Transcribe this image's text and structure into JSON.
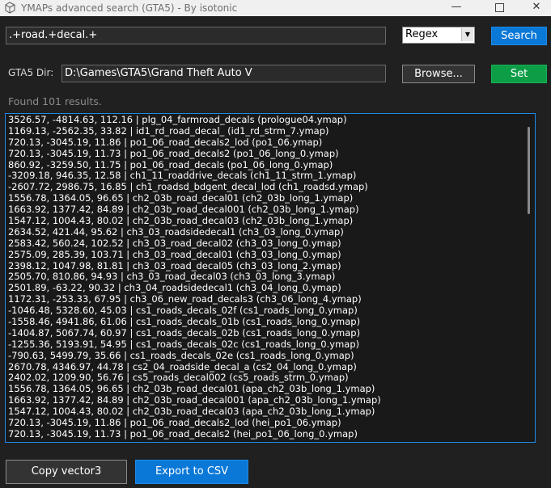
{
  "window": {
    "title": "YMAPs advanced search (GTA5) - By isotonic",
    "minimize_glyph": "—",
    "close_glyph": "✕"
  },
  "search": {
    "query": ".+road.+decal.+",
    "mode": "Regex",
    "button_label": "Search"
  },
  "dir": {
    "label": "GTA5 Dir:",
    "path": "D:\\Games\\GTA5\\Grand Theft Auto V",
    "browse_label": "Browse...",
    "set_label": "Set"
  },
  "status": "Found 101 results.",
  "results": [
    "3526.57, -4814.63, 112.16 | plg_04_farmroad_decals (prologue04.ymap)",
    "1169.13, -2562.35, 33.82 | id1_rd_road_decal_ (id1_rd_strm_7.ymap)",
    "720.13, -3045.19, 11.86 | po1_06_road_decals2_lod (po1_06.ymap)",
    "720.13, -3045.19, 11.73 | po1_06_road_decals2 (po1_06_long_0.ymap)",
    "860.92, -3259.50, 11.75 | po1_06_road_decals (po1_06_long_0.ymap)",
    "-3209.18, 946.35, 12.58 | ch1_11_roaddrive_decals (ch1_11_strm_1.ymap)",
    "-2607.72, 2986.75, 16.85 | ch1_roadsd_bdgent_decal_lod (ch1_roadsd.ymap)",
    "1556.78, 1364.05, 96.65 | ch2_03b_road_decal01 (ch2_03b_long_1.ymap)",
    "1663.92, 1377.42, 84.89 | ch2_03b_road_decal001 (ch2_03b_long_1.ymap)",
    "1547.12, 1004.43, 80.02 | ch2_03b_road_decal03 (ch2_03b_long_1.ymap)",
    "2634.52, 421.44, 95.62 | ch3_03_roadsidedecal1 (ch3_03_long_0.ymap)",
    "2583.42, 560.24, 102.52 | ch3_03_road_decal02 (ch3_03_long_0.ymap)",
    "2575.09, 285.39, 103.71 | ch3_03_road_decal01 (ch3_03_long_0.ymap)",
    "2398.12, 1047.98, 81.81 | ch3_03_road_decal05 (ch3_03_long_2.ymap)",
    "2505.70, 810.86, 94.93 | ch3_03_road_decal03 (ch3_03_long_3.ymap)",
    "2501.89, -63.22, 90.32 | ch3_04_roadsidedecal1 (ch3_04_long_0.ymap)",
    "1172.31, -253.33, 67.95 | ch3_06_new_road_decals3 (ch3_06_long_4.ymap)",
    "-1046.48, 5328.60, 45.03 | cs1_roads_decals_02f (cs1_roads_long_0.ymap)",
    "-1558.46, 4941.86, 61.06 | cs1_roads_decals_01b (cs1_roads_long_0.ymap)",
    "-1404.87, 5067.74, 60.97 | cs1_roads_decals_02b (cs1_roads_long_0.ymap)",
    "-1255.36, 5193.91, 54.95 | cs1_roads_decals_02c (cs1_roads_long_0.ymap)",
    "-790.63, 5499.79, 35.66 | cs1_roads_decals_02e (cs1_roads_long_0.ymap)",
    "2670.78, 4346.97, 44.78 | cs2_04_roadside_decal_a (cs2_04_long_0.ymap)",
    "2402.02, 1209.90, 56.76 | cs5_roads_decal002 (cs5_roads_strm_0.ymap)",
    "1556.78, 1364.05, 96.65 | ch2_03b_road_decal01 (apa_ch2_03b_long_1.ymap)",
    "1663.92, 1377.42, 84.89 | ch2_03b_road_decal001 (apa_ch2_03b_long_1.ymap)",
    "1547.12, 1004.43, 80.02 | ch2_03b_road_decal03 (apa_ch2_03b_long_1.ymap)",
    "720.13, -3045.19, 11.86 | po1_06_road_decals2_lod (hei_po1_06.ymap)",
    "720.13, -3045.19, 11.73 | po1_06_road_decals2 (hei_po1_06_long_0.ymap)"
  ],
  "footer": {
    "copy_label": "Copy vector3",
    "export_label": "Export to CSV"
  }
}
